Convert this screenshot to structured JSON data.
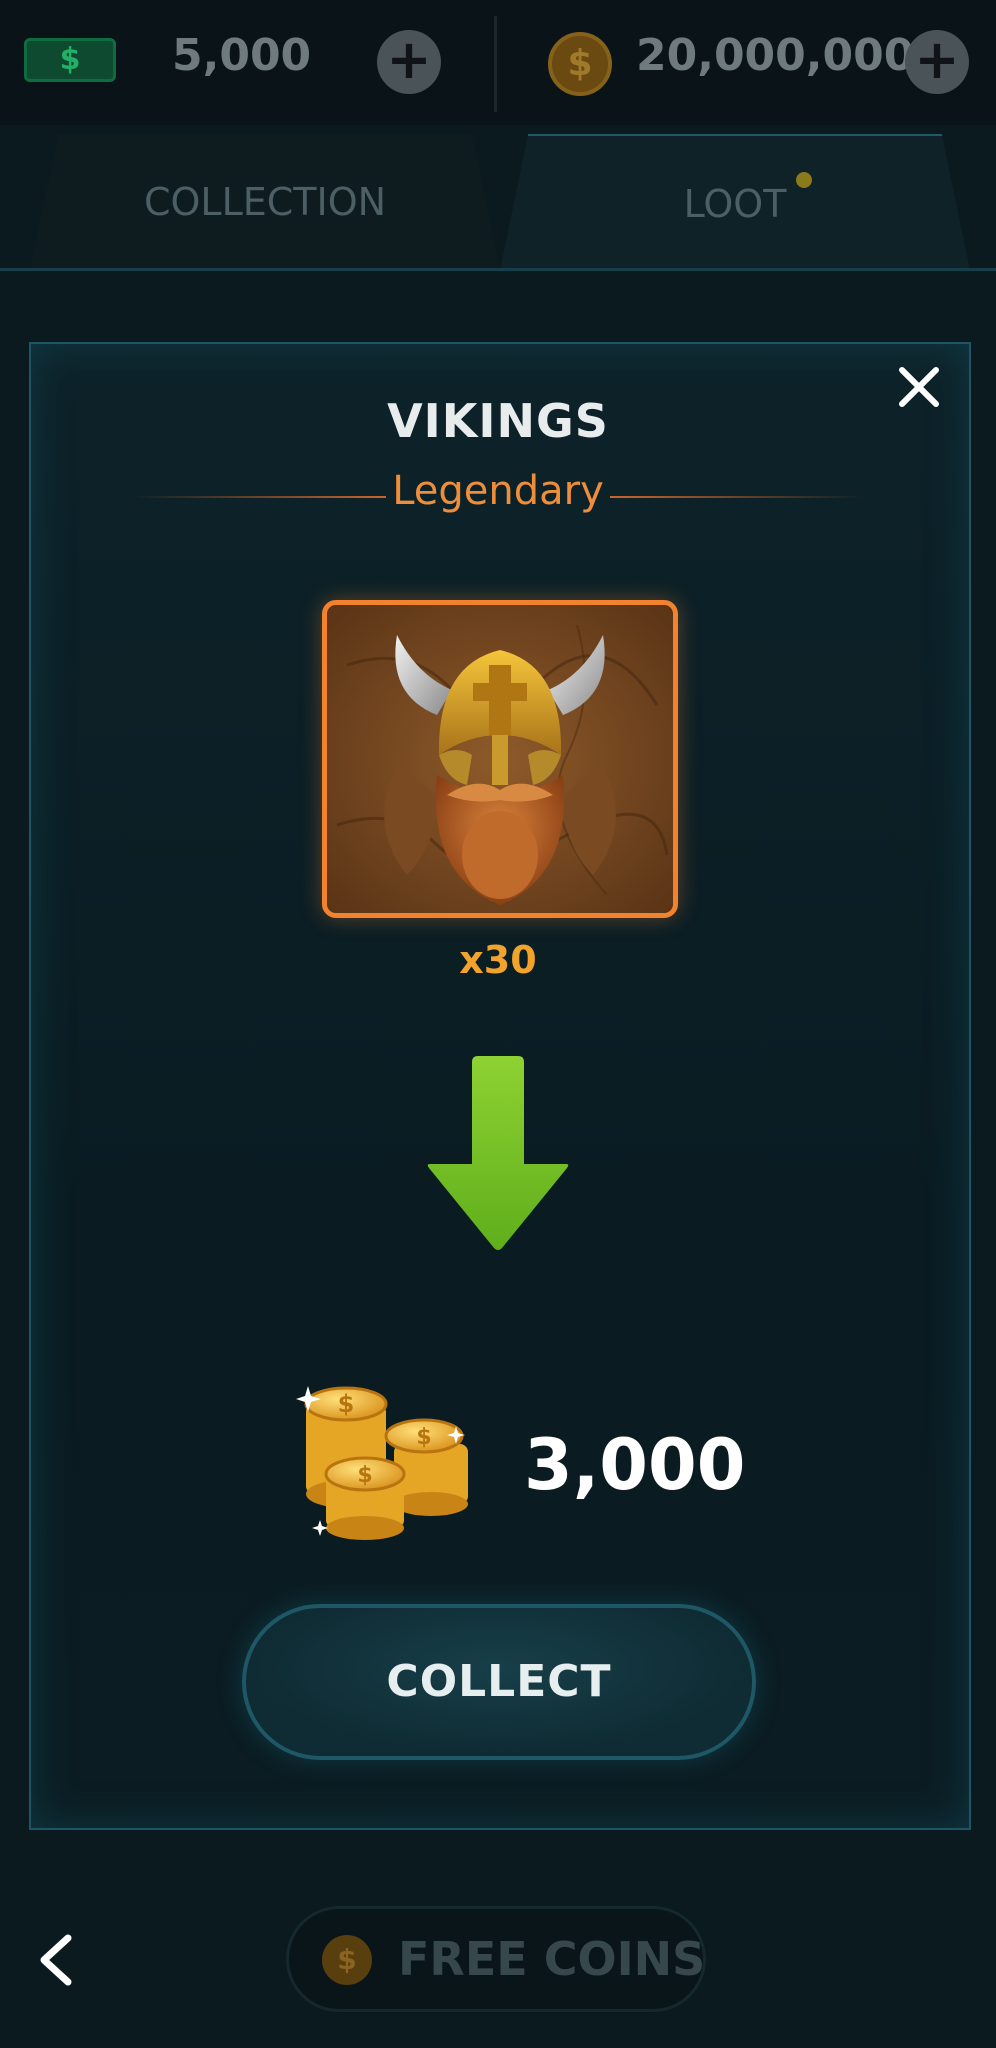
{
  "header": {
    "cash_symbol": "$",
    "cash_value": "5,000",
    "coin_symbol": "$",
    "coin_value": "20,000,000"
  },
  "tabs": {
    "collection": "COLLECTION",
    "loot": "LOOT"
  },
  "modal": {
    "title": "VIKINGS",
    "rarity": "Legendary",
    "quantity": "x30",
    "reward_amount": "3,000",
    "collect_label": "COLLECT"
  },
  "footer": {
    "coin_symbol": "$",
    "free_coins_label": "FREE COINS"
  },
  "colors": {
    "rarity": "#ee8d3a",
    "quantity": "#f1a32c",
    "arrow": "#7cc52e",
    "card_border": "#f3822f"
  }
}
